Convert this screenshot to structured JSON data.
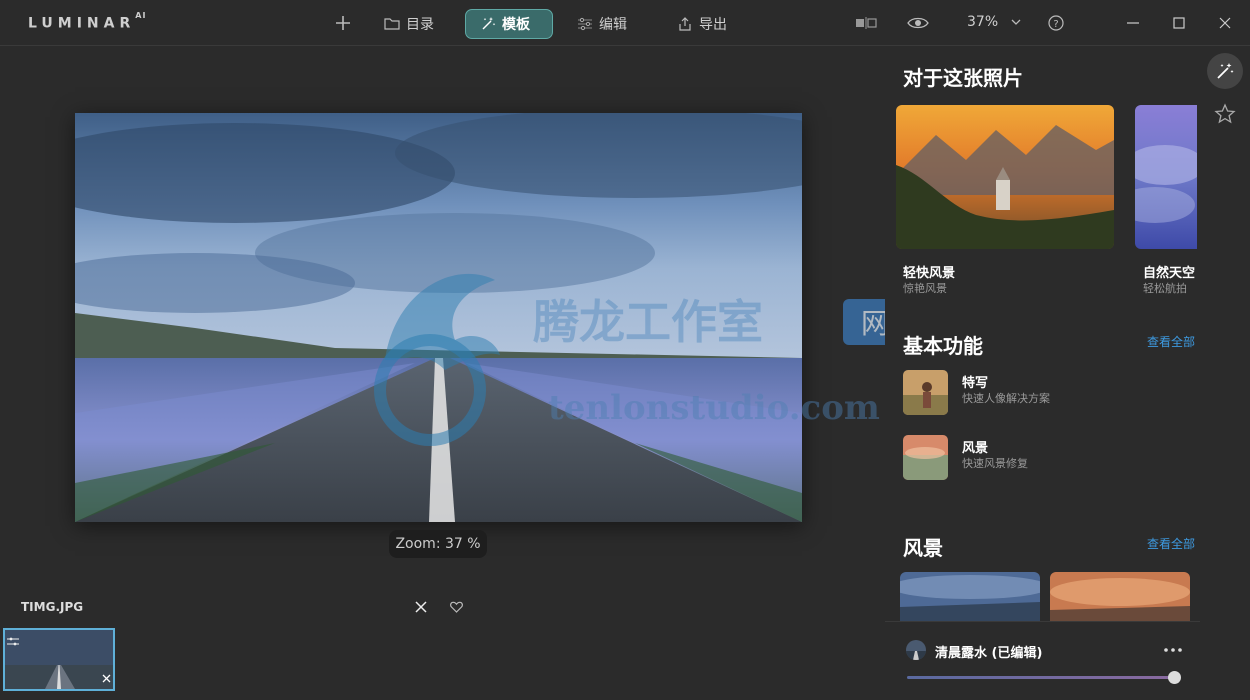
{
  "app": {
    "logo": "LUMINAR",
    "logo_sup": "AI"
  },
  "toolbar": {
    "catalog_label": "目录",
    "templates_label": "模板",
    "edit_label": "编辑",
    "export_label": "导出",
    "zoom_value": "37%"
  },
  "canvas": {
    "zoom_tip": "Zoom: 37 %",
    "file_name": "TIMG.JPG"
  },
  "watermark": {
    "cn": "腾龙工作室",
    "site": "网站",
    "url": "tenlonstudio.com"
  },
  "right": {
    "for_photo_title": "对于这张照片",
    "cards": [
      {
        "title": "轻快风景",
        "subtitle": "惊艳风景"
      },
      {
        "title": "自然天空",
        "subtitle": "轻松航拍"
      }
    ],
    "essentials_title": "基本功能",
    "view_all": "查看全部",
    "features": [
      {
        "title": "特写",
        "subtitle": "快速人像解决方案"
      },
      {
        "title": "风景",
        "subtitle": "快速风景修复"
      }
    ],
    "landscape_title": "风景",
    "landscape_view_all": "查看全部"
  },
  "bottom": {
    "template_name": "清晨露水 (已编辑)"
  },
  "colors": {
    "accent": "#3a6b6a",
    "link": "#3e9ae0",
    "bg": "#2b2b2b"
  }
}
